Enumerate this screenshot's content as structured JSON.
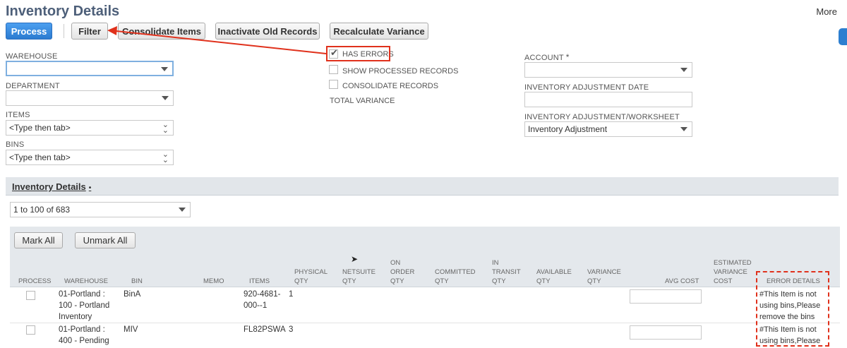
{
  "page": {
    "title": "Inventory Details",
    "more_label": "More"
  },
  "toolbar": {
    "process_label": "Process",
    "filter_label": "Filter",
    "consolidate_label": "Consolidate Items",
    "inactivate_label": "Inactivate Old Records",
    "recalculate_label": "Recalculate Variance"
  },
  "filters": {
    "warehouse_label": "WAREHOUSE",
    "warehouse_value": "",
    "department_label": "DEPARTMENT",
    "department_value": "",
    "items_label": "ITEMS",
    "items_value": "<Type then tab>",
    "bins_label": "BINS",
    "bins_value": "<Type then tab>",
    "has_errors_label": "HAS ERRORS",
    "has_errors_checked": true,
    "show_processed_label": "SHOW PROCESSED RECORDS",
    "consolidate_records_label": "CONSOLIDATE RECORDS",
    "total_variance_label": "TOTAL VARIANCE",
    "account_label": "ACCOUNT",
    "account_required_mark": "*",
    "account_value": "",
    "adj_date_label": "INVENTORY ADJUSTMENT DATE",
    "adj_date_value": "",
    "adj_worksheet_label": "INVENTORY ADJUSTMENT/WORKSHEET",
    "adj_worksheet_value": "Inventory Adjustment"
  },
  "sublist": {
    "title": "Inventory Details",
    "title_marker": "•",
    "pager_value": "1 to 100 of 683",
    "mark_all_label": "Mark All",
    "unmark_all_label": "Unmark All",
    "columns": {
      "process": "PROCESS",
      "warehouse": "WAREHOUSE",
      "bin": "BIN",
      "memo": "MEMO",
      "items": "ITEMS",
      "physical_qty": "PHYSICAL QTY",
      "netsuite_qty": "NETSUITE QTY",
      "on_order_qty": "ON ORDER QTY",
      "committed_qty": "COMMITTED QTY",
      "in_transit_qty": "IN TRANSIT QTY",
      "available_qty": "AVAILABLE QTY",
      "variance_qty": "VARIANCE QTY",
      "avg_cost": "AVG COST",
      "est_variance_cost": "ESTIMATED VARIANCE COST",
      "error_details": "ERROR DETAILS"
    },
    "rows": [
      {
        "warehouse": "01-Portland : 100 - Portland Inventory",
        "bin": "BinA",
        "items": "920-4681-000--1",
        "physical_qty": "1",
        "error": "#This Item is not using bins,Please remove the bins"
      },
      {
        "warehouse": "01-Portland : 400 - Pending",
        "bin": "MIV",
        "items": "FL82PSWA",
        "physical_qty": "3",
        "error": "#This Item is not using bins,Please"
      }
    ]
  },
  "colors": {
    "accent_blue": "#2b7bd0",
    "annotation_red": "#e0311c",
    "title_slate": "#4d5f79"
  },
  "icons": [
    "dropdown-caret-icon",
    "double-chevron-icon",
    "checkmark-icon",
    "mouse-cursor-icon",
    "annotation-arrow-icon"
  ]
}
